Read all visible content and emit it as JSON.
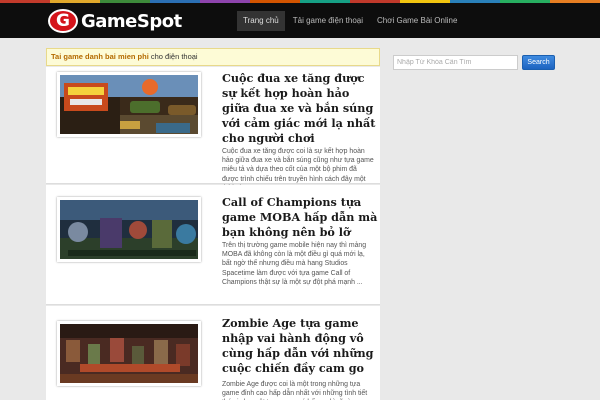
{
  "brand": {
    "logo_letter": "G",
    "logo_text": "GameSpot",
    "logo_color": "#d4141b",
    "stripe_colors": [
      "#c23a2b",
      "#e0a82b",
      "#3d8a3a",
      "#2b6fb3",
      "#8e44ad",
      "#d35400",
      "#16a085",
      "#c0392b",
      "#f1c40f",
      "#2980b9",
      "#27ae60",
      "#e67e22"
    ]
  },
  "nav": {
    "items": [
      {
        "label": "Trang chủ",
        "active": true
      },
      {
        "label": "Tải game điện thoại",
        "active": false
      },
      {
        "label": "Chơi Game Bài Online",
        "active": false
      }
    ]
  },
  "notice": {
    "link_text": "Tai game danh bai mien phi",
    "rest_text": " cho điện thoại"
  },
  "posts": [
    {
      "title": "Cuộc đua xe tăng được sự kết hợp hoàn hảo giữa đua xe và bắn súng với cảm giác mới lạ nhất cho người chơi",
      "excerpt": "Cuộc đua xe tăng được coi là sự kết hợp hoàn hảo giữa đua xe và bắn súng cũng như tựa game miêu tả và dựa theo cốt của một bộ phim đã được trình chiếu trên truyền hình cách đây một thời gian . ...",
      "thumb_icon": "racing-tank-thumbnail"
    },
    {
      "title": "Call of Champions tựa game MOBA hấp dẫn mà bạn không nên bỏ lỡ",
      "excerpt": "Trên thị trường game mobile hiện nay thì mảng MOBA đã không còn là một điều gì quá mới lạ, bất ngờ thế nhưng điều mà hang Studios Spacetime làm được với tựa game Call of Champions thật sự là một sự đột phá mạnh ...",
      "thumb_icon": "call-of-champions-thumbnail"
    },
    {
      "title": "Zombie Age tựa game nhập vai hành động vô cùng hấp dẫn với những cuộc chiến đầy cam go",
      "excerpt": "Zombie Age được coi là một trong những tựa game đỉnh cao hấp dẫn nhất với những tình tiết thú vị cho một tựa game có bố cục kì rõ ràng",
      "thumb_icon": "zombie-age-thumbnail"
    }
  ],
  "search": {
    "placeholder": "Nhập Từ Khóa Cần Tìm",
    "value": "",
    "button_label": "Search"
  }
}
